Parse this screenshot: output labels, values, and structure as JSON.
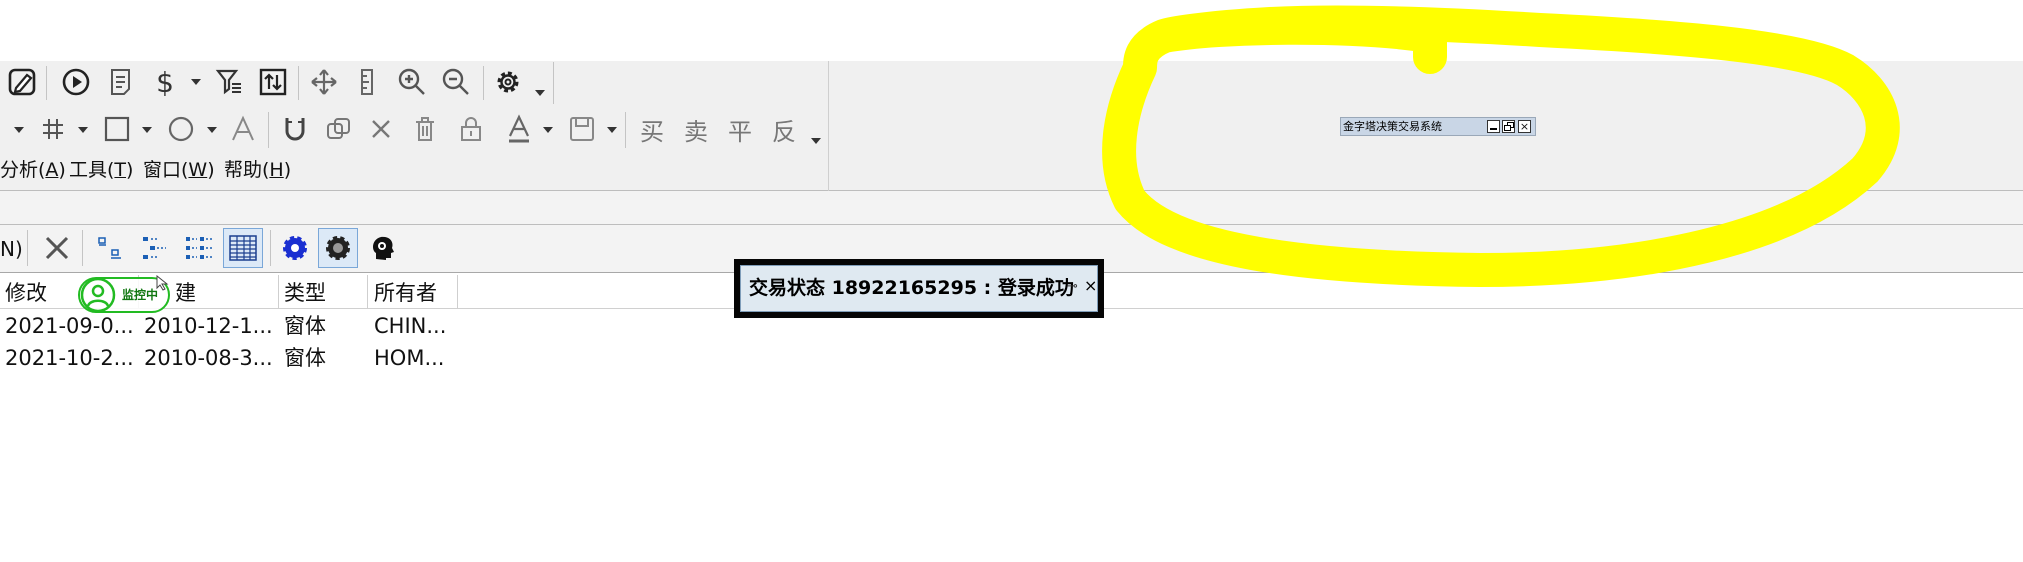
{
  "menu": {
    "items": [
      {
        "label": "分析(A)",
        "shown": "分析(",
        "hotkey": "A",
        "close": ")"
      },
      {
        "label": "工具(T)",
        "shown": "工具(",
        "hotkey": "T",
        "close": ")"
      },
      {
        "label": "窗口(W)",
        "shown": "窗口(",
        "hotkey": "W",
        "close": ")"
      },
      {
        "label": "帮助(H)",
        "shown": "帮助(",
        "hotkey": "H",
        "close": ")"
      }
    ]
  },
  "toolbar2": {
    "trade_buttons": [
      "买",
      "卖",
      "平",
      "反"
    ]
  },
  "toolbar3": {
    "left_cutoff_label": "N)"
  },
  "mini_window": {
    "title": "金字塔决策交易系统"
  },
  "trade_status": {
    "text": "交易状态 18922165295 : 登录成功",
    "pin": "⊸",
    "close": "×"
  },
  "monitor_badge": {
    "label": "监控中",
    "color": "#22bb22"
  },
  "table": {
    "headers": [
      "修改",
      "建",
      "类型",
      "所有者"
    ],
    "rows": [
      [
        "2021-09-0...",
        "2010-12-1...",
        "窗体",
        "CHIN..."
      ],
      [
        "2021-10-2...",
        "2010-08-3...",
        "窗体",
        "HOM..."
      ]
    ]
  },
  "annotation": {
    "color": "#ffff00"
  }
}
